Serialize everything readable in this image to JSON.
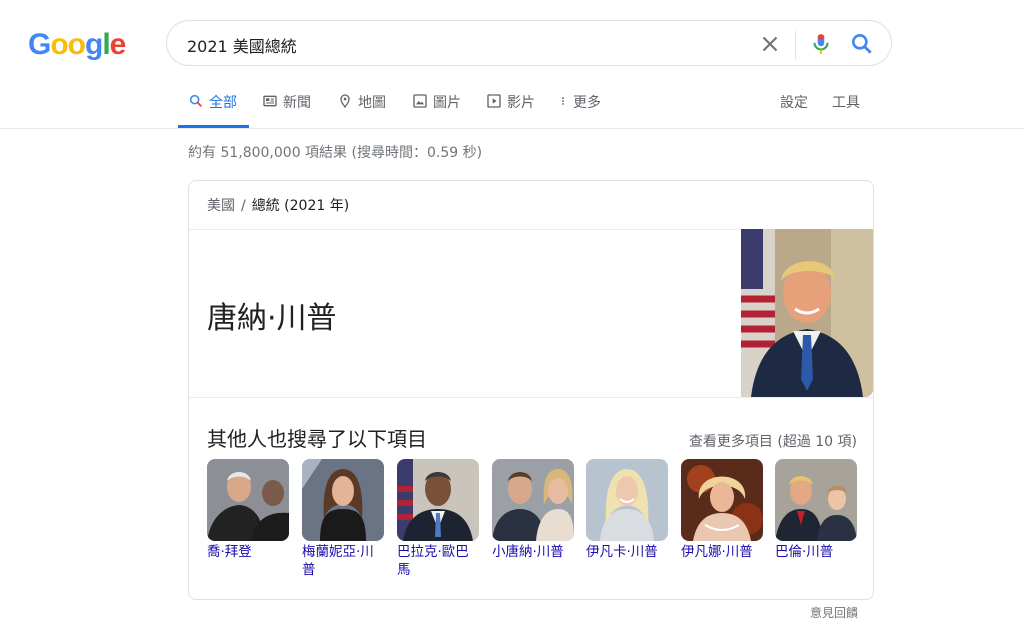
{
  "logo": {
    "letters": [
      "G",
      "o",
      "o",
      "g",
      "l",
      "e"
    ],
    "colors": [
      "#4285f4",
      "#fbbc05",
      "#fbbc05",
      "#4285f4",
      "#34a853",
      "#ea4335"
    ]
  },
  "search": {
    "query": "2021 美國總統"
  },
  "tabs": [
    {
      "label": "全部",
      "icon": "search-icon"
    },
    {
      "label": "新聞",
      "icon": "news-icon"
    },
    {
      "label": "地圖",
      "icon": "map-pin-icon"
    },
    {
      "label": "圖片",
      "icon": "image-icon"
    },
    {
      "label": "影片",
      "icon": "video-icon"
    },
    {
      "label": "更多",
      "icon": "more-vert-icon"
    }
  ],
  "tools": {
    "settings": "設定",
    "tools": "工具"
  },
  "stats": "約有 51,800,000 項結果 (搜尋時間：0.59 秒)",
  "card": {
    "breadcrumb": [
      "美國",
      "總統 (2021 年)"
    ],
    "answer": "唐納·川普",
    "also_searched_title": "其他人也搜尋了以下項目",
    "see_more": "查看更多項目 (超過 10 項)",
    "people": [
      {
        "name": "喬·拜登"
      },
      {
        "name": "梅蘭妮亞·川普"
      },
      {
        "name": "巴拉克·歐巴馬"
      },
      {
        "name": "小唐納·川普"
      },
      {
        "name": "伊凡卡·川普"
      },
      {
        "name": "伊凡娜·川普"
      },
      {
        "name": "巴倫·川普"
      }
    ]
  },
  "feedback": "意見回饋",
  "colors": {
    "accent": "#1a73e8",
    "link": "#1a0dab",
    "mic_blue": "#4285f4",
    "mic_red": "#ea4335"
  }
}
